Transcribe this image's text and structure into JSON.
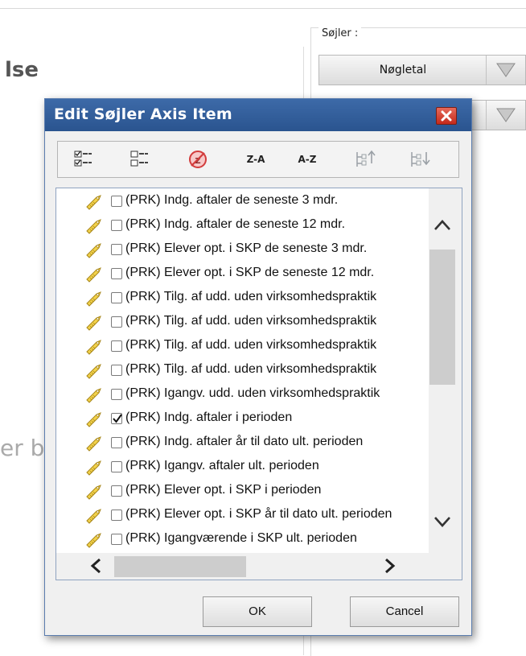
{
  "background": {
    "heading_fragment": "lse",
    "ghost_fragment": "er b",
    "soejler_legend": "Søjler :",
    "dropdowns": [
      {
        "value": "Nøgletal"
      },
      {
        "value": ""
      }
    ]
  },
  "dialog": {
    "title": "Edit Søjler Axis Item",
    "toolbar": [
      {
        "icon": "check-all-icon",
        "label": ""
      },
      {
        "icon": "uncheck-all-icon",
        "label": ""
      },
      {
        "icon": "clear-sort-icon",
        "label": ""
      },
      {
        "icon": "sort-desc-icon",
        "label": "Z-A"
      },
      {
        "icon": "sort-asc-icon",
        "label": "A-Z"
      },
      {
        "icon": "move-up-icon",
        "label": ""
      },
      {
        "icon": "move-down-icon",
        "label": ""
      }
    ],
    "items": [
      {
        "label": "(PRK) Indg. aftaler de seneste 3 mdr.",
        "checked": false
      },
      {
        "label": "(PRK) Indg. aftaler de seneste 12 mdr.",
        "checked": false
      },
      {
        "label": "(PRK) Elever opt. i SKP de seneste 3 mdr.",
        "checked": false
      },
      {
        "label": "(PRK) Elever opt. i SKP de seneste 12 mdr.",
        "checked": false
      },
      {
        "label": "(PRK) Tilg. af udd. uden virksomhedspraktik",
        "checked": false
      },
      {
        "label": "(PRK) Tilg. af udd. uden virksomhedspraktik",
        "checked": false
      },
      {
        "label": "(PRK) Tilg. af udd. uden virksomhedspraktik",
        "checked": false
      },
      {
        "label": "(PRK) Tilg. af udd. uden virksomhedspraktik",
        "checked": false
      },
      {
        "label": "(PRK) Igangv. udd. uden virksomhedspraktik",
        "checked": false
      },
      {
        "label": "(PRK) Indg. aftaler i perioden",
        "checked": true
      },
      {
        "label": "(PRK) Indg. aftaler år til dato ult. perioden",
        "checked": false
      },
      {
        "label": "(PRK) Igangv. aftaler ult. perioden",
        "checked": false
      },
      {
        "label": "(PRK) Elever opt. i SKP i perioden",
        "checked": false
      },
      {
        "label": "(PRK) Elever opt. i SKP år til dato ult. perioden",
        "checked": false
      },
      {
        "label": "(PRK) Igangværende i SKP ult. perioden",
        "checked": false
      }
    ],
    "ok_label": "OK",
    "cancel_label": "Cancel"
  }
}
